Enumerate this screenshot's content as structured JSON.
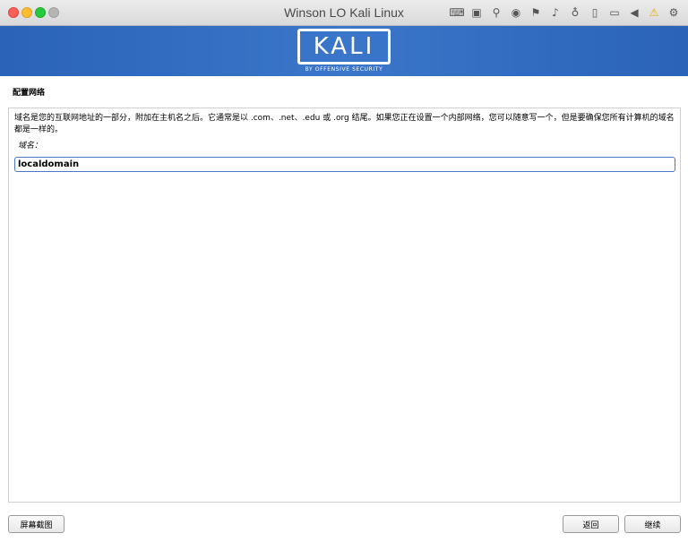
{
  "window": {
    "title": "Winson LO Kali Linux",
    "toolbar_icons": [
      "keyboard-icon",
      "chip-icon",
      "usb-icon",
      "disc-icon",
      "network-icon",
      "speaker-icon",
      "microphone-icon",
      "phone-icon",
      "camera-icon",
      "back-arrow-icon",
      "warning-icon",
      "gear-icon"
    ]
  },
  "banner": {
    "logo": "KALI",
    "tagline": "BY OFFENSIVE SECURITY"
  },
  "page": {
    "section_title": "配置网络",
    "description": "域名是您的互联网地址的一部分，附加在主机名之后。它通常是以 .com、.net、.edu 或 .org 结尾。如果您正在设置一个内部网络，您可以随意写一个，但是要确保您所有计算机的域名都是一样的。",
    "field_label": "域名：",
    "domain_value": "localdomain"
  },
  "buttons": {
    "screenshot": "屏幕截图",
    "back": "返回",
    "continue": "继续"
  },
  "colors": {
    "banner": "#3a76c9",
    "focus_border": "#4a77c8"
  }
}
